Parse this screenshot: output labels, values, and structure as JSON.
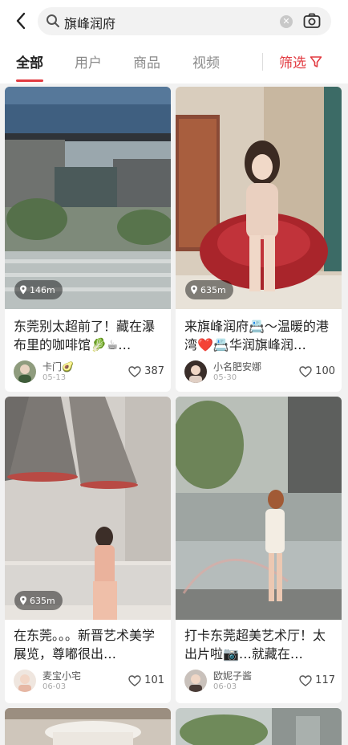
{
  "search": {
    "query": "旗峰润府"
  },
  "tabs": [
    "全部",
    "用户",
    "商品",
    "视频"
  ],
  "filter_label": "筛选",
  "cards": [
    {
      "title": "东莞别太超前了！藏在瀑布里的咖啡馆🥬☕…",
      "author": "卡门🥑",
      "date": "05-13",
      "likes": "387",
      "distance": "146m"
    },
    {
      "title": "来旗峰润府📇～温暖的港湾❤️📇华润旗峰润…",
      "author": "小名肥安娜",
      "date": "05-30",
      "likes": "100",
      "distance": "635m"
    },
    {
      "title": "在东莞。。。新晋艺术美学展览，尊嘟很出…",
      "author": "麦宝小宅",
      "date": "06-03",
      "likes": "101",
      "distance": "635m"
    },
    {
      "title": "打卡东莞超美艺术厅！太出片啦📷…就藏在…",
      "author": "欧妮子酱",
      "date": "06-03",
      "likes": "117",
      "distance": ""
    }
  ]
}
